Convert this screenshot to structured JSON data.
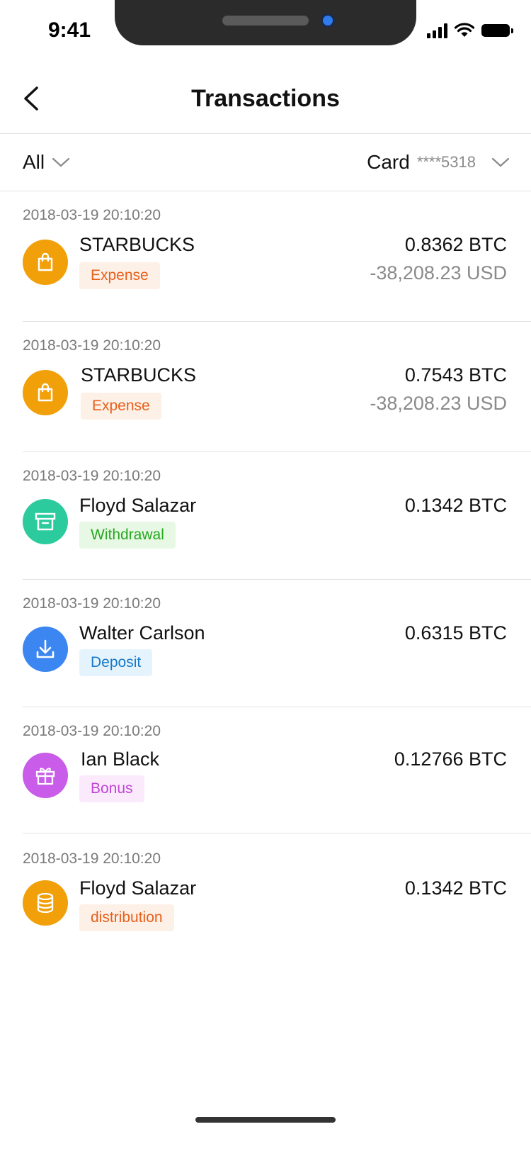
{
  "status_bar": {
    "time": "9:41"
  },
  "header": {
    "title": "Transactions",
    "back_icon": "chevron-left-icon"
  },
  "filter": {
    "type_label": "All",
    "card_label": "Card",
    "card_number": "****5318"
  },
  "transactions": [
    {
      "date": "2018-03-19 20:10:20",
      "name": "STARBUCKS",
      "tag": "Expense",
      "btc": "0.8362 BTC",
      "usd": "-38,208.23 USD",
      "icon": "shopping-bag-icon",
      "icon_color": "#F2A00A",
      "tag_color": "#E8601C",
      "tag_bg": "#FDF0E6"
    },
    {
      "date": "2018-03-19 20:10:20",
      "name": "STARBUCKS",
      "tag": "Expense",
      "btc": "0.7543 BTC",
      "usd": "-38,208.23 USD",
      "icon": "shopping-bag-icon",
      "icon_color": "#F2A00A",
      "tag_color": "#E8601C",
      "tag_bg": "#FDF0E6"
    },
    {
      "date": "2018-03-19 20:10:20",
      "name": "Floyd Salazar",
      "tag": "Withdrawal",
      "btc": "0.1342 BTC",
      "icon": "archive-box-icon",
      "icon_color": "#2CCB9E",
      "tag_color": "#26A81E",
      "tag_bg": "#E7F8E5"
    },
    {
      "date": "2018-03-19 20:10:20",
      "name": "Walter Carlson",
      "tag": "Deposit",
      "btc": "0.6315 BTC",
      "icon": "download-icon",
      "icon_color": "#3B86F0",
      "tag_color": "#1A78C8",
      "tag_bg": "#E5F4FC"
    },
    {
      "date": "2018-03-19 20:10:20",
      "name": "Ian Black",
      "tag": "Bonus",
      "btc": "0.12766 BTC",
      "icon": "gift-icon",
      "icon_color": "#C95CE8",
      "tag_color": "#C146D8",
      "tag_bg": "#FBE9FC"
    },
    {
      "date": "2018-03-19 20:10:20",
      "name": "Floyd Salazar",
      "tag": "distribution",
      "btc": "0.1342 BTC",
      "icon": "database-icon",
      "icon_color": "#F2A00A",
      "tag_color": "#E8601C",
      "tag_bg": "#FDF0E6"
    }
  ]
}
